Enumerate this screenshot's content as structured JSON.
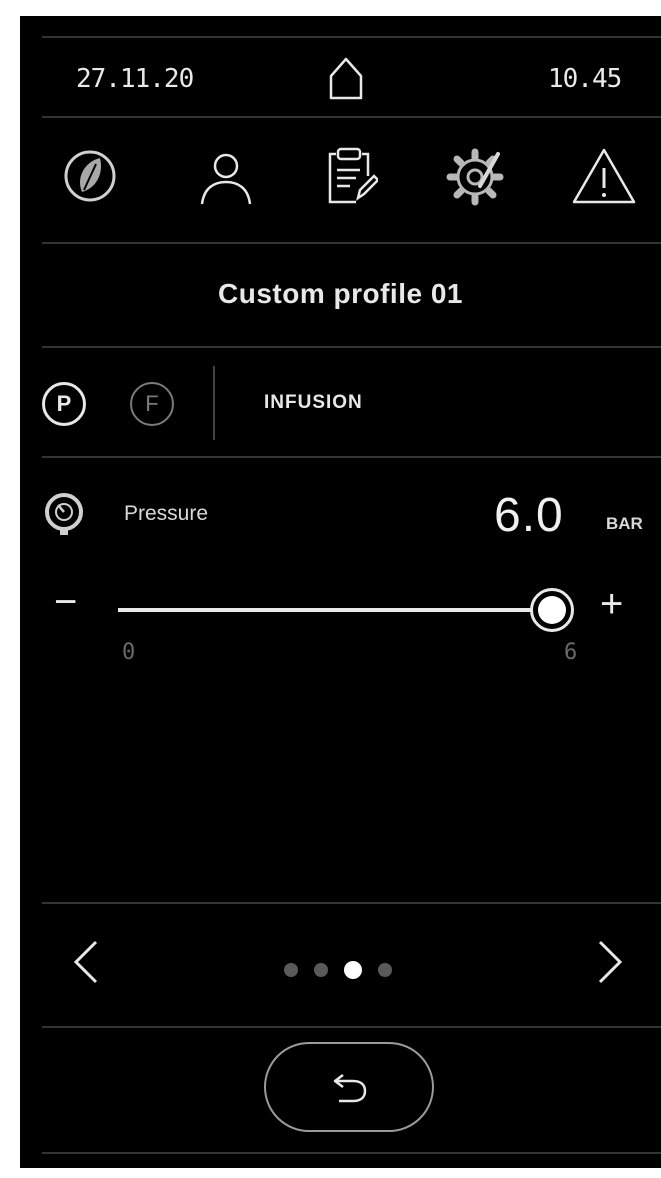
{
  "status_bar": {
    "date": "27.11.20",
    "time": "10.45"
  },
  "nav_icons": [
    "leaf-icon",
    "user-icon",
    "clipboard-edit-icon",
    "gear-icon",
    "warning-icon"
  ],
  "profile": {
    "title": "Custom profile 01"
  },
  "modes": {
    "pressure_badge": "P",
    "flow_badge": "F",
    "phase_label": "INFUSION"
  },
  "pressure": {
    "label": "Pressure",
    "value": "6.0",
    "unit": "BAR",
    "min_label": "0",
    "max_label": "6",
    "level": 1.0,
    "decrement_label": "−",
    "increment_label": "+"
  },
  "pager": {
    "page_count": 4,
    "current_page": 3
  },
  "colors": {
    "background": "#000000",
    "text": "#e8e8e8",
    "divider": "#333333",
    "inactive": "#6a6a6a"
  }
}
